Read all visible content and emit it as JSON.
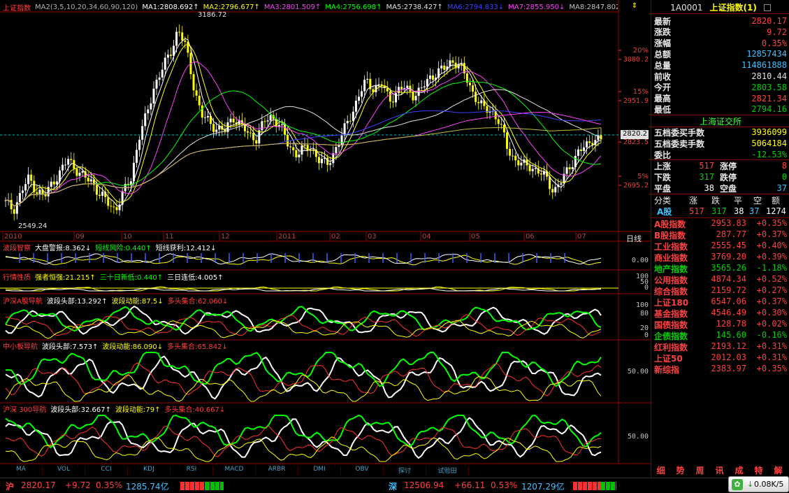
{
  "colors": {
    "up": "#ff4040",
    "down": "#00d000",
    "ma1": "#ffffff",
    "ma2": "#ffff00",
    "ma3": "#ff00ff",
    "ma4": "#00ff00",
    "ma5": "#40a0ff",
    "ma6": "#2020ff",
    "ma7": "#ff40ff",
    "ma8": "#c0c000"
  },
  "main_chart": {
    "title": "上证指数",
    "legend": [
      {
        "text": "MA2(3,5,10,20,34,60,90,120)",
        "color": "#b0b0b0"
      },
      {
        "text": "MA1:2808.692↑",
        "color": "#ffffff"
      },
      {
        "text": "MA2:2796.677↑",
        "color": "#ffff00"
      },
      {
        "text": "MA3:2801.509↑",
        "color": "#ff40ff"
      },
      {
        "text": "MA4:2756.698↑",
        "color": "#00ff00"
      },
      {
        "text": "MA5:2738.427↑",
        "color": "#e0e0e0"
      },
      {
        "text": "MA6:2794.833↓",
        "color": "#4040ff"
      },
      {
        "text": "MA7:2855.950↓",
        "color": "#ff40ff"
      },
      {
        "text": "MA8:2847.802↓",
        "color": "#c0c0c0"
      }
    ],
    "high_label": "3186.72",
    "low_label": "2549.24",
    "y_labels": [
      "3080.2",
      "2951.9",
      "2823.5",
      "2695.2"
    ],
    "pct_labels": [
      "20%",
      "15%",
      "5%"
    ],
    "current_price": "2820.2",
    "x_labels": [
      "2010",
      "09",
      "10",
      "11",
      "12",
      "2011",
      "02",
      "03",
      "04",
      "05",
      "06",
      "07"
    ],
    "period_label": "日线",
    "close_series": [
      2620,
      2600,
      2655,
      2700,
      2660,
      2640,
      2690,
      2720,
      2760,
      2730,
      2700,
      2690,
      2650,
      2620,
      2600,
      2650,
      2700,
      2830,
      2900,
      3000,
      3050,
      3100,
      3180,
      3120,
      3000,
      2900,
      2880,
      2860,
      2850,
      2900,
      2870,
      2840,
      2830,
      2880,
      2900,
      2870,
      2810,
      2780,
      2790,
      2800,
      2760,
      2740,
      2790,
      2840,
      2900,
      2960,
      3010,
      2990,
      3000,
      2950,
      2980,
      2990,
      2970,
      2980,
      3020,
      3040,
      3050,
      3080,
      3060,
      3010,
      2960,
      2920,
      2920,
      2880,
      2800,
      2760,
      2740,
      2740,
      2720,
      2700,
      2660,
      2690,
      2740,
      2780,
      2800,
      2830,
      2820
    ]
  },
  "panels": [
    {
      "name": "波段智察",
      "labels": [
        {
          "t": "波段智察",
          "c": "#ff4040"
        },
        {
          "t": "大盘警报:8.362↓",
          "c": "#ffffff"
        },
        {
          "t": "短线风险:0.440↑",
          "c": "#00ff00"
        },
        {
          "t": "短线获利:12.412↓",
          "c": "#ffffff"
        }
      ],
      "right": [
        "0.00"
      ]
    },
    {
      "name": "行情性质",
      "labels": [
        {
          "t": "行情性质",
          "c": "#ff4040"
        },
        {
          "t": "强者恒强:21.215↑",
          "c": "#ffff00"
        },
        {
          "t": "三十日新低:0.440↑",
          "c": "#00ff00"
        },
        {
          "t": "三日连低:4.005↑",
          "c": "#ffffff"
        }
      ],
      "right": [
        "100",
        "50",
        "0"
      ]
    },
    {
      "name": "沪深A股导航",
      "labels": [
        {
          "t": "沪深A股导航",
          "c": "#ff4040"
        },
        {
          "t": "波段头部:13.292↑",
          "c": "#ffffff"
        },
        {
          "t": "波段动能:87.5↓",
          "c": "#ffff00"
        },
        {
          "t": "多头集合:62.060↓",
          "c": "#ff4040"
        }
      ],
      "right": [
        "100",
        "80",
        "20",
        "0"
      ]
    },
    {
      "name": "中小板导航",
      "labels": [
        {
          "t": "中小板导航",
          "c": "#ff4040"
        },
        {
          "t": "波段头部:7.573↑",
          "c": "#ffffff"
        },
        {
          "t": "波段动能:86.090↓",
          "c": "#ffff00"
        },
        {
          "t": "多头集合:65.842↓",
          "c": "#ff4040"
        }
      ],
      "right": [
        "50.00"
      ]
    },
    {
      "name": "沪深300导航",
      "labels": [
        {
          "t": "沪深 300导航",
          "c": "#ff4040"
        },
        {
          "t": "波段头部:32.667↑",
          "c": "#ffffff"
        },
        {
          "t": "波段动能:79↑",
          "c": "#ffff00"
        },
        {
          "t": "多头集合:40.667↓",
          "c": "#ff4040"
        }
      ],
      "right": [
        "50.00"
      ]
    }
  ],
  "bottom_tabs": [
    "MA",
    "VOL",
    "CCI",
    "KDJ",
    "RSI",
    "MACD",
    "ARBR",
    "DMI",
    "OBV",
    "探讨",
    "试验田"
  ],
  "quote": {
    "code": "1A0001",
    "name": "上证指数(1)",
    "rows": [
      {
        "l": "最新",
        "v": "2820.17",
        "c": "#ff4040"
      },
      {
        "l": "涨跌",
        "v": "9.72",
        "c": "#ff4040"
      },
      {
        "l": "涨幅",
        "v": "0.35%",
        "c": "#ff4040"
      },
      {
        "l": "总额",
        "v": "12857434",
        "c": "#40c0ff"
      },
      {
        "l": "总量",
        "v": "114861888",
        "c": "#40c0ff"
      },
      {
        "l": "前收",
        "v": "2810.44",
        "c": "#e0e0e0"
      },
      {
        "l": "今开",
        "v": "2803.58",
        "c": "#00d000"
      },
      {
        "l": "最高",
        "v": "2821.34",
        "c": "#ff4040"
      },
      {
        "l": "最低",
        "v": "2794.16",
        "c": "#00d000"
      }
    ],
    "exchange": "上海证交所",
    "order_rows": [
      {
        "l": "五档委买手数",
        "v": "3936099",
        "c": "#ffff00"
      },
      {
        "l": "五档委卖手数",
        "v": "5064184",
        "c": "#ffff00"
      },
      {
        "l": "委比",
        "v": "-12.53%",
        "c": "#00d000"
      }
    ],
    "breadth": [
      {
        "l1": "上涨",
        "v1": "517",
        "c1": "#ff4040",
        "l2": "涨停",
        "v2": "8",
        "c2": "#ff4040"
      },
      {
        "l1": "下跌",
        "v1": "317",
        "c1": "#00d000",
        "l2": "跌停",
        "v2": "0",
        "c2": "#00d000"
      },
      {
        "l1": "平盘",
        "v1": "38",
        "c1": "#ffffff",
        "l2": "空盘",
        "v2": "37",
        "c2": "#40c0ff"
      }
    ],
    "cat_header": [
      "分类",
      "涨",
      "跌",
      "平",
      "空",
      "额"
    ],
    "cat_row": {
      "name": "A股",
      "up": "517",
      "down": "317",
      "flat": "38",
      "empty": "37",
      "amt": "1274"
    },
    "indices": [
      {
        "n": "A股指数",
        "p": "2953.83",
        "c": "+0.35%",
        "neg": false
      },
      {
        "n": "B股指数",
        "p": "287.77",
        "c": "+0.37%",
        "neg": false
      },
      {
        "n": "工业指数",
        "p": "2555.45",
        "c": "+0.40%",
        "neg": false
      },
      {
        "n": "商业指数",
        "p": "3769.20",
        "c": "+0.39%",
        "neg": false
      },
      {
        "n": "地产指数",
        "p": "3565.26",
        "c": "-1.18%",
        "neg": true
      },
      {
        "n": "公用指数",
        "p": "4874.34",
        "c": "+0.52%",
        "neg": false
      },
      {
        "n": "综合指数",
        "p": "2159.72",
        "c": "+0.27%",
        "neg": false
      },
      {
        "n": "上证180",
        "p": "6547.06",
        "c": "+0.37%",
        "neg": false
      },
      {
        "n": "基金指数",
        "p": "4546.49",
        "c": "+0.30%",
        "neg": false
      },
      {
        "n": "国债指数",
        "p": "128.78",
        "c": "+0.02%",
        "neg": false
      },
      {
        "n": "企债指数",
        "p": "145.60",
        "c": "-0.16%",
        "neg": true
      },
      {
        "n": "红利指数",
        "p": "2193.12",
        "c": "+0.31%",
        "neg": false
      },
      {
        "n": "上证50",
        "p": "2012.03",
        "c": "+0.31%",
        "neg": false
      },
      {
        "n": "新综指",
        "p": "2383.97",
        "c": "+0.35%",
        "neg": false
      }
    ],
    "tabs": [
      "细",
      "势",
      "周",
      "讯",
      "成",
      "特",
      "解"
    ]
  },
  "status": {
    "sh_label": "沪",
    "sh_price": "2820.17",
    "sh_chg": "+9.72",
    "sh_pct": "0.35%",
    "sh_amt": "1285.74亿",
    "sz_label": "深",
    "sz_price": "12506.94",
    "sz_chg": "+66.11",
    "sz_pct": "0.53%",
    "sz_amt": "1207.29亿",
    "speed": "0.08K/5"
  }
}
